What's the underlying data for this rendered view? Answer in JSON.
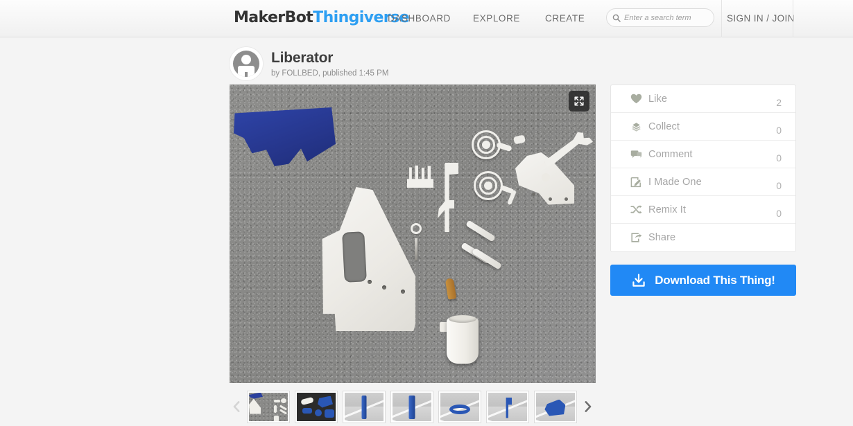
{
  "header": {
    "logo_brand": "MakerBot",
    "logo_product": "Thingiverse",
    "nav": {
      "dashboard": "DASHBOARD",
      "explore": "EXPLORE",
      "create": "CREATE"
    },
    "search": {
      "placeholder": "Enter a search term",
      "value": "",
      "icon": "search-icon"
    },
    "signin": "SIGN IN / JOIN"
  },
  "thing": {
    "title": "Liberator",
    "meta": "by FOLLBED, published 1:45 PM",
    "author": "FOLLBED",
    "published": "1:45 PM",
    "avatar_icon": "default-user-avatar",
    "expand_icon": "fullscreen-expand-icon"
  },
  "sidebar": {
    "actions": [
      {
        "label": "Like",
        "count": "2",
        "icon": "heart-icon"
      },
      {
        "label": "Collect",
        "count": "0",
        "icon": "collection-icon"
      },
      {
        "label": "Comment",
        "count": "0",
        "icon": "comment-icon"
      },
      {
        "label": "I Made One",
        "count": "0",
        "icon": "pencil-square-icon"
      },
      {
        "label": "Remix It",
        "count": "0",
        "icon": "shuffle-icon"
      },
      {
        "label": "Share",
        "count": "",
        "icon": "share-icon"
      }
    ],
    "download_label": "Download This Thing!",
    "download_icon": "download-icon",
    "download_color": "#2189f5"
  },
  "gallery": {
    "prev_icon": "chevron-left-icon",
    "next_icon": "chevron-right-icon",
    "thumbnails": [
      {
        "name": "thumb-parts-on-carpet",
        "selected": true
      },
      {
        "name": "thumb-parts-dark-bg",
        "selected": false
      },
      {
        "name": "thumb-blue-cylinder-a",
        "selected": false
      },
      {
        "name": "thumb-blue-cylinder-b",
        "selected": false
      },
      {
        "name": "thumb-blue-ring",
        "selected": false
      },
      {
        "name": "thumb-blue-hook",
        "selected": false
      },
      {
        "name": "thumb-blue-grip",
        "selected": false
      }
    ]
  },
  "colors": {
    "accent_blue": "#2189f5",
    "logo_blue": "#2e9ff2",
    "page_bg": "#f4f4f4",
    "header_bg": "#f7f7f7",
    "icon_sage": "#a8ada0",
    "muted_text": "#a6a6a6"
  }
}
